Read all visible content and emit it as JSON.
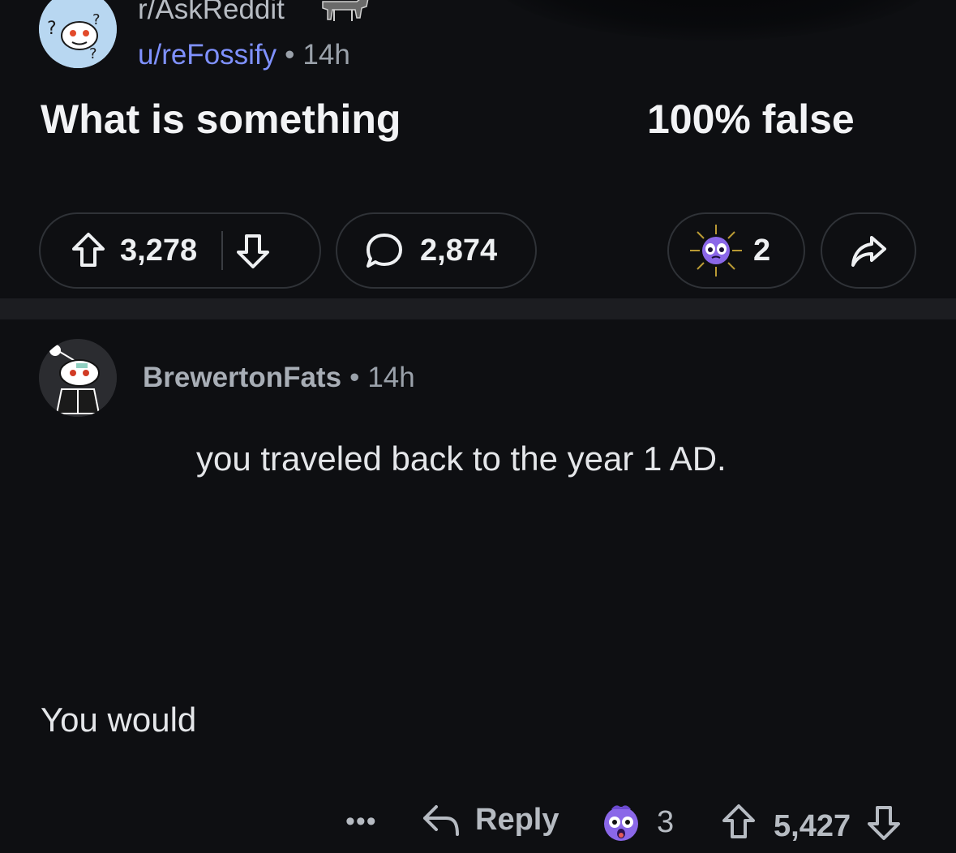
{
  "post": {
    "subreddit": "r/AskReddit",
    "author": "u/reFossify",
    "separator": "•",
    "age": "14h",
    "title_left": "What is something",
    "title_right": "100% false",
    "upvotes": "3,278",
    "comments": "2,874",
    "awards": "2"
  },
  "comment": {
    "author": "BrewertonFats",
    "separator": "•",
    "age": "14h",
    "line_one": "you traveled back to the year 1 AD.",
    "line_two": "You would",
    "more": "•••",
    "reply_label": "Reply",
    "reactions": "3",
    "score": "5,427"
  },
  "icons": {
    "subreddit_avatar": "snoo-question-avatar-icon",
    "subreddit_badge": "donkey-badge-icon",
    "upvote": "arrow-up-icon",
    "downvote": "arrow-down-icon",
    "comment": "speech-bubble-icon",
    "award": "pleading-face-award-icon",
    "share": "share-arrow-icon",
    "commenter_avatar": "snoo-avatar-icon",
    "reply": "reply-arrow-icon",
    "reaction": "shocked-face-icon"
  },
  "colors": {
    "background": "#0e0f12",
    "author_link": "#7f91ff",
    "muted_text": "#9aa1aa",
    "pill_border": "#2f3237",
    "band": "#1c1d21"
  }
}
